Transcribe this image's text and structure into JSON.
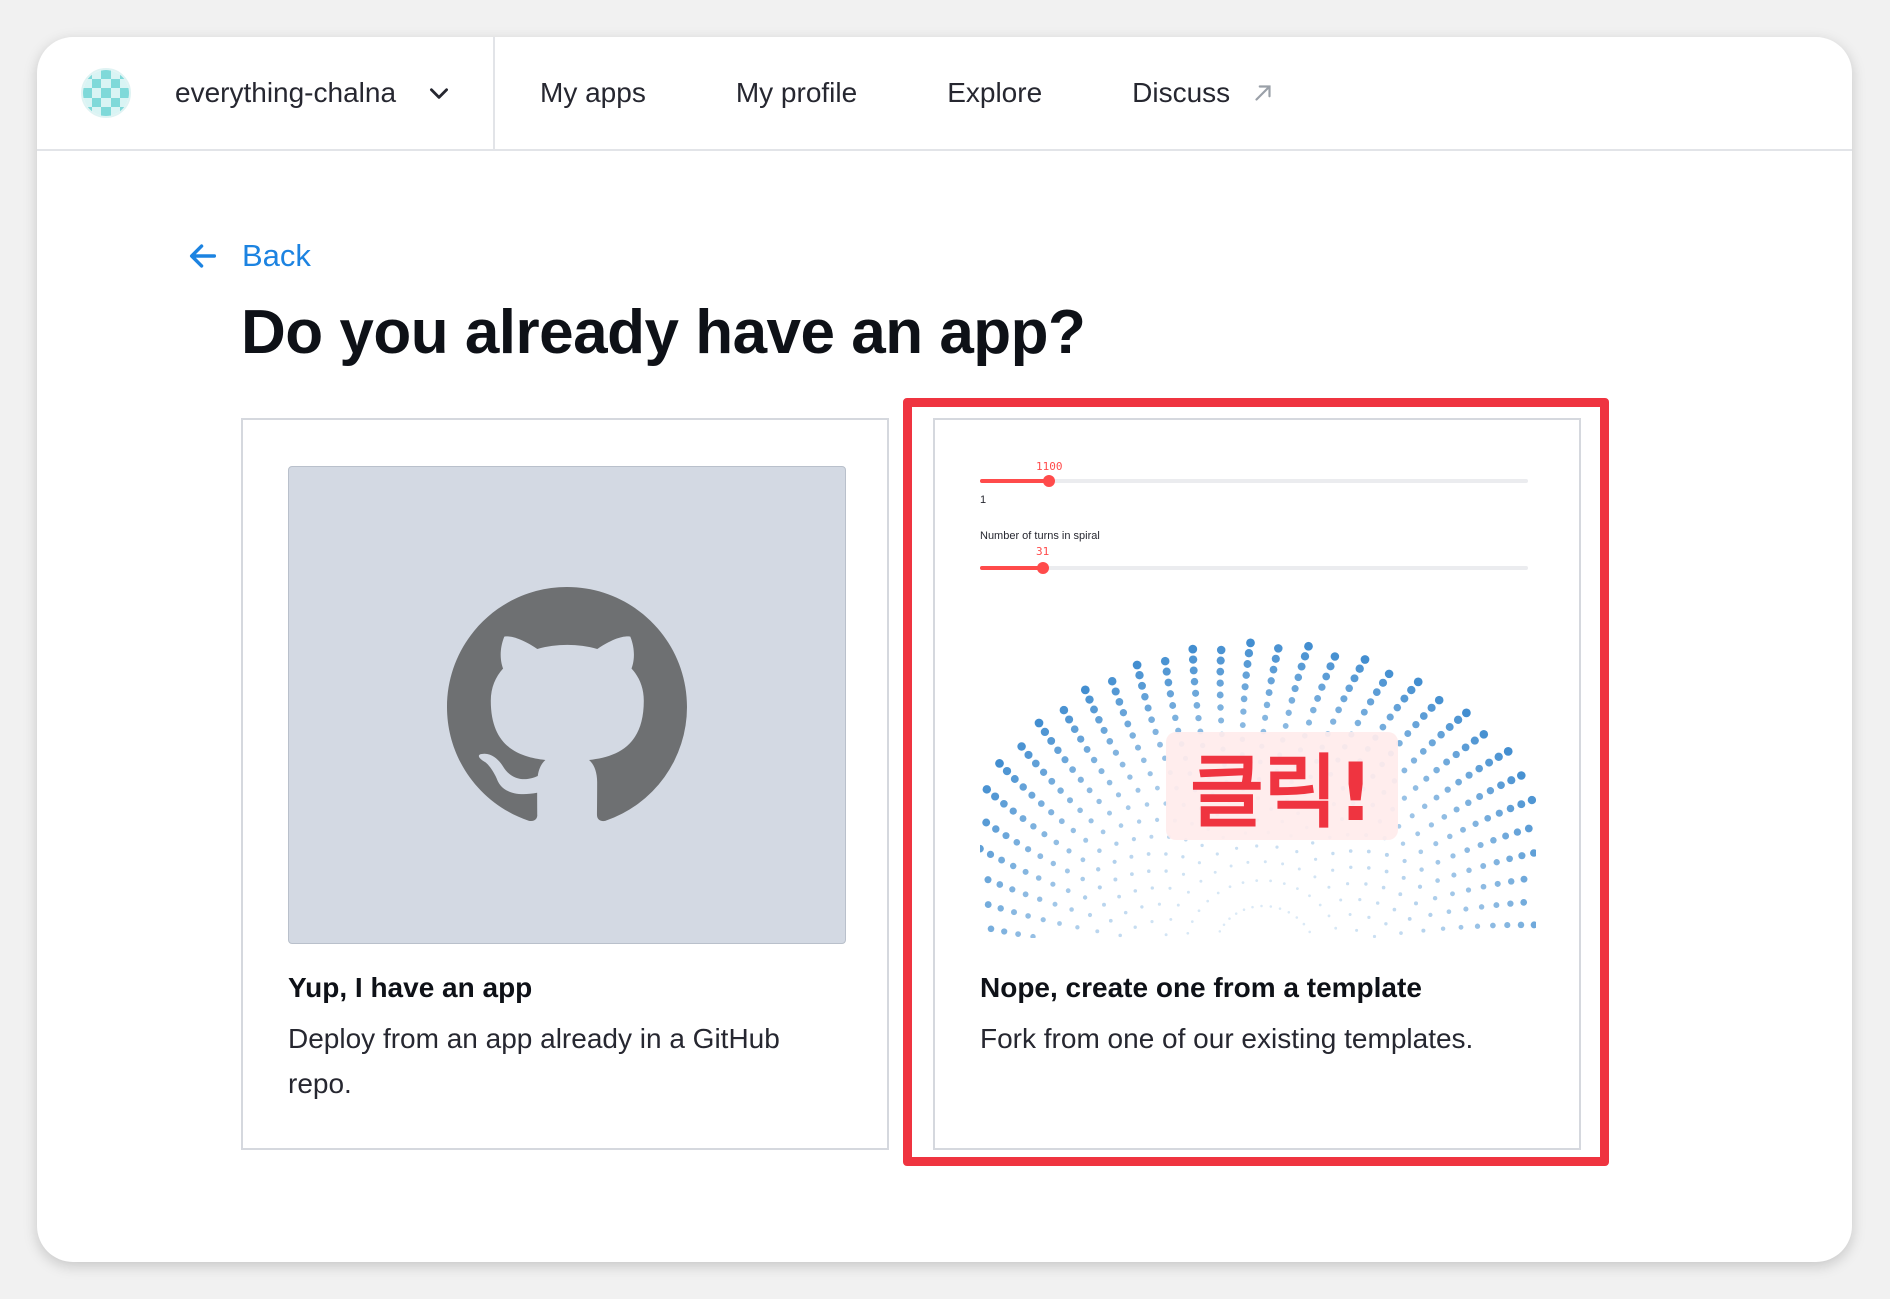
{
  "header": {
    "workspace_name": "everything-chalna",
    "workspace_icon": "checker-avatar-icon",
    "nav": [
      {
        "label": "My apps"
      },
      {
        "label": "My profile"
      },
      {
        "label": "Explore"
      },
      {
        "label": "Discuss",
        "icon": "external-arrow-icon"
      }
    ]
  },
  "main": {
    "back_label": "Back",
    "title": "Do you already have an app?",
    "options": [
      {
        "title": "Yup, I have an app",
        "description": "Deploy from an app already in a GitHub repo.",
        "icon": "github-icon"
      },
      {
        "title": "Nope, create one from a template",
        "description": "Fork from one of our existing templates.",
        "preview": {
          "slider1_value": "1100",
          "slider1_min": "1",
          "slider1_fraction": 0.125,
          "slider2_label": "Number of turns in spiral",
          "slider2_value": "31",
          "slider2_fraction": 0.115
        }
      }
    ]
  },
  "annotation": {
    "badge_text": "클릭!",
    "color": "#ef3440"
  },
  "colors": {
    "accent": "#1c83e1",
    "streamlit_red": "#ff4b4b"
  }
}
